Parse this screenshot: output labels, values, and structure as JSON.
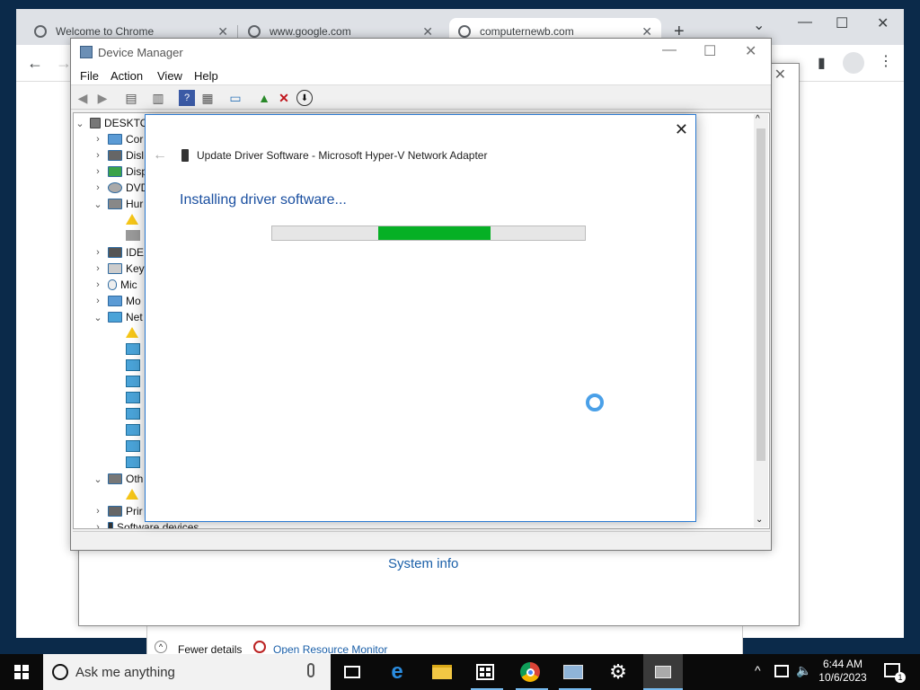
{
  "chrome": {
    "tabs": [
      {
        "title": "Welcome to Chrome"
      },
      {
        "title": "www.google.com"
      },
      {
        "title": "computernewb.com"
      }
    ]
  },
  "background_dialog": {
    "system_info_link": "System info"
  },
  "background_taskwin": {
    "fewer_details": "Fewer details",
    "open_resource_monitor": "Open Resource Monitor"
  },
  "device_manager": {
    "title": "Device Manager",
    "menu": [
      "File",
      "Action",
      "View",
      "Help"
    ],
    "tree": {
      "root": "DESKTO",
      "items": [
        "Cor",
        "Disl",
        "Disp",
        "DVD",
        "Hur",
        "IDE",
        "Key",
        "Mic",
        "Mo",
        "Net",
        "Oth",
        "Prir",
        "Software devices"
      ]
    }
  },
  "update_driver": {
    "title": "Update Driver Software - Microsoft Hyper-V Network Adapter",
    "heading": "Installing driver software...",
    "progress_fraction_start": 0.34,
    "progress_fraction_end": 0.7
  },
  "taskbar": {
    "search_placeholder": "Ask me anything",
    "time": "6:44 AM",
    "date": "10/6/2023",
    "notification_count": "1"
  },
  "colors": {
    "progress_green": "#06b025",
    "dialog_heading": "#1a4fa0",
    "spinner": "#4aa0e8"
  }
}
